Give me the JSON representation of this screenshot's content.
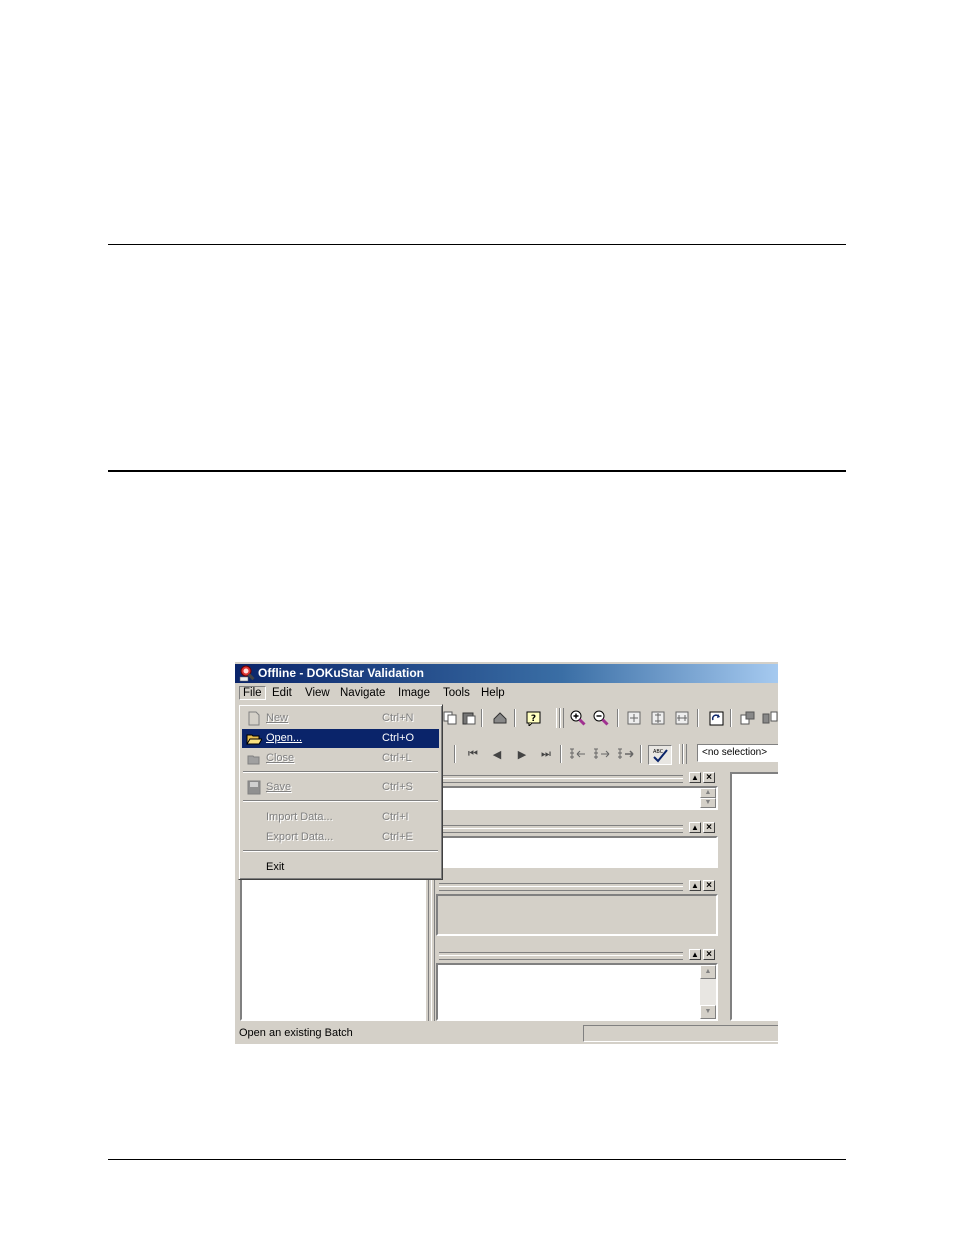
{
  "window": {
    "title": "Offline - DOKuStar Validation"
  },
  "menubar": {
    "items": [
      "File",
      "Edit",
      "View",
      "Navigate",
      "Image",
      "Tools",
      "Help"
    ]
  },
  "file_menu": {
    "new": {
      "label": "New",
      "shortcut": "Ctrl+N",
      "enabled": false
    },
    "open": {
      "label": "Open...",
      "shortcut": "Ctrl+O",
      "enabled": true
    },
    "close": {
      "label": "Close",
      "shortcut": "Ctrl+L",
      "enabled": false
    },
    "save": {
      "label": "Save",
      "shortcut": "Ctrl+S",
      "enabled": false
    },
    "import": {
      "label": "Import Data...",
      "shortcut": "Ctrl+I",
      "enabled": false
    },
    "export": {
      "label": "Export Data...",
      "shortcut": "Ctrl+E",
      "enabled": false
    },
    "exit": {
      "label": "Exit",
      "enabled": true
    }
  },
  "toolbar": {
    "selection_value": "<no selection>"
  },
  "statusbar": {
    "text": "Open an existing Batch"
  },
  "colors": {
    "titlebar_start": "#0a246a",
    "highlight": "#0a246a",
    "face": "#d4d0c8"
  }
}
